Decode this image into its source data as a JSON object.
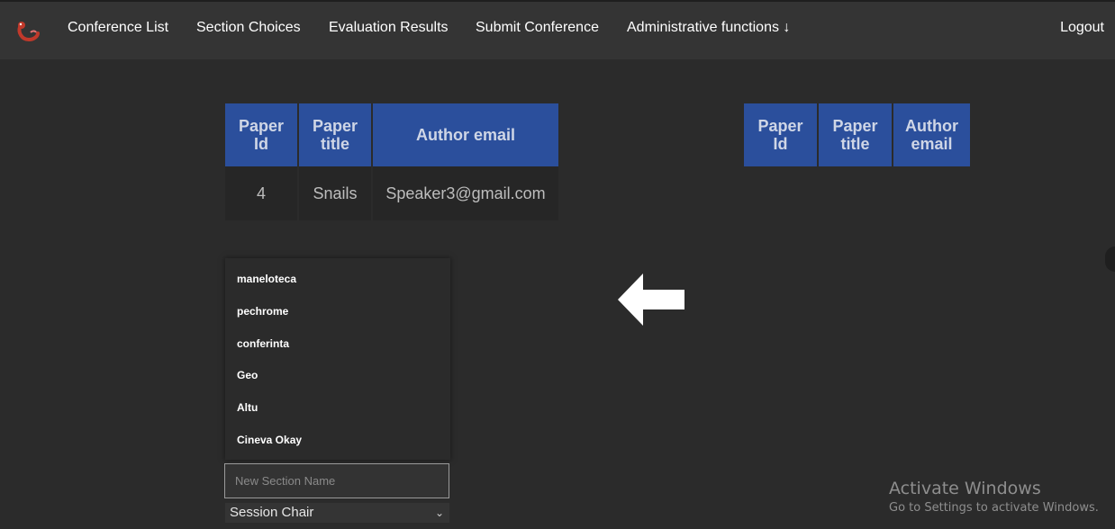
{
  "nav": {
    "links": [
      "Conference List",
      "Section Choices",
      "Evaluation Results",
      "Submit Conference",
      "Administrative functions ↓"
    ],
    "logout": "Logout",
    "logo_icon": "worm-logo-icon"
  },
  "left_table": {
    "headers": [
      "Paper\nId",
      "Paper\ntitle",
      "Author email"
    ],
    "rows": [
      [
        "4",
        "Snails",
        "Speaker3@gmail.com"
      ]
    ]
  },
  "right_table": {
    "headers": [
      "Paper\nId",
      "Paper\ntitle",
      "Author\nemail"
    ],
    "rows": []
  },
  "sections": {
    "items": [
      "maneloteca",
      "pechrome",
      "conferinta",
      "Geo",
      "Altu",
      "Cineva Okay"
    ]
  },
  "new_section": {
    "placeholder": "New Section Name",
    "value": ""
  },
  "session_select": {
    "selected": "Session Chair"
  },
  "arrow_icon": "arrow-left-icon",
  "watermark": {
    "title": "Activate Windows",
    "subtitle": "Go to Settings to activate Windows."
  },
  "colors": {
    "background": "#2b2b2b",
    "navbar": "#343434",
    "table_header": "#2b4f9c",
    "table_cell": "#262626"
  }
}
